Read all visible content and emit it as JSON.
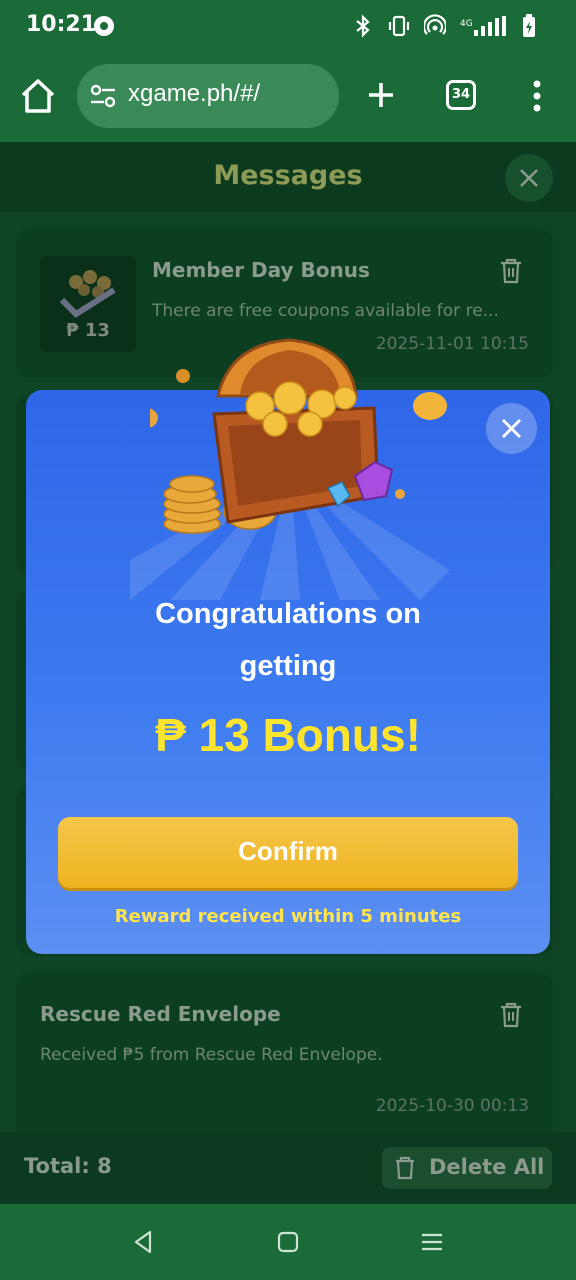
{
  "status_bar": {
    "time": "10:21",
    "icons": [
      "chat-bubble-icon",
      "bluetooth-icon",
      "vibrate-icon",
      "hotspot-icon",
      "signal-4g-icon",
      "battery-charging-icon"
    ]
  },
  "browser": {
    "url": "xgame.ph/#/",
    "tab_count": "34"
  },
  "page": {
    "title": "Messages",
    "messages": [
      {
        "title": "Member Day Bonus",
        "body": "There are free coupons available for re...",
        "date": "2025-11-01 10:15",
        "thumb_label": "₱ 13"
      },
      {
        "title": "Rescue Red Envelope",
        "body": "Received ₱5 from Rescue Red Envelope.",
        "date": "2025-10-30 00:13"
      }
    ],
    "total_label": "Total: 8",
    "delete_all_label": "Delete All"
  },
  "modal": {
    "line1": "Congratulations on",
    "line2": "getting",
    "bonus_text": "₱ 13 Bonus!",
    "confirm_label": "Confirm",
    "note": "Reward received within 5 minutes"
  },
  "colors": {
    "browser_green": "#1a6b37",
    "modal_blue": "#3d7bf0",
    "bonus_yellow": "#ffe42e",
    "confirm_gold": "#f0b424"
  }
}
